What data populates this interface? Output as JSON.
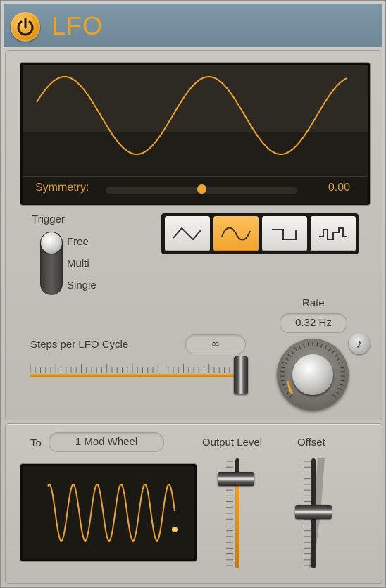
{
  "header": {
    "title": "LFO"
  },
  "display": {
    "symmetry_label": "Symmetry:",
    "symmetry_value": "0.00",
    "symmetry_level": 0.5
  },
  "trigger": {
    "label": "Trigger",
    "options": [
      "Free",
      "Multi",
      "Single"
    ],
    "selected": "Free"
  },
  "waveforms": {
    "options": [
      "triangle-icon",
      "sine-icon",
      "square-icon",
      "random-square-icon"
    ],
    "selected": "sine-icon"
  },
  "rate": {
    "label": "Rate",
    "value": "0.32 Hz"
  },
  "steps": {
    "label": "Steps per LFO Cycle",
    "value": "∞",
    "level": 1.0
  },
  "modulation": {
    "to_label": "To",
    "destination": "1 Mod Wheel",
    "output_level_label": "Output Level",
    "offset_label": "Offset",
    "output_level": 0.85,
    "offset": 0.45
  },
  "colors": {
    "accent": "#f2a22b",
    "header": "#7890a0",
    "panel": "#c5c3bc",
    "display_bg": "#1f1e19"
  }
}
